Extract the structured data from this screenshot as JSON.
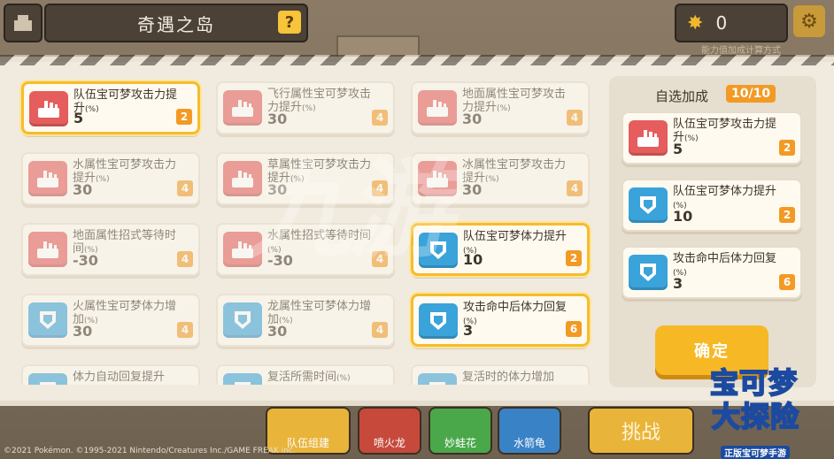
{
  "header": {
    "title": "奇遇之岛",
    "help_label": "?",
    "coins": "0",
    "sub_caption": "能力值加成计算方式"
  },
  "panel": {
    "options": [
      {
        "name": "队伍宝可梦攻击力提升",
        "pct": "(%)",
        "value": "5",
        "cost": "2",
        "icon": "red",
        "selected": true,
        "dim": false
      },
      {
        "name": "飞行属性宝可梦攻击力提升",
        "pct": "(%)",
        "value": "30",
        "cost": "4",
        "icon": "red",
        "selected": false,
        "dim": true
      },
      {
        "name": "地面属性宝可梦攻击力提升",
        "pct": "(%)",
        "value": "30",
        "cost": "4",
        "icon": "red",
        "selected": false,
        "dim": true
      },
      {
        "name": "水属性宝可梦攻击力提升",
        "pct": "(%)",
        "value": "30",
        "cost": "4",
        "icon": "red",
        "selected": false,
        "dim": true
      },
      {
        "name": "草属性宝可梦攻击力提升",
        "pct": "(%)",
        "value": "30",
        "cost": "4",
        "icon": "red",
        "selected": false,
        "dim": true
      },
      {
        "name": "冰属性宝可梦攻击力提升",
        "pct": "(%)",
        "value": "30",
        "cost": "4",
        "icon": "red",
        "selected": false,
        "dim": true
      },
      {
        "name": "地面属性招式等待时间",
        "pct": "(%)",
        "value": "-30",
        "cost": "4",
        "icon": "red",
        "selected": false,
        "dim": true
      },
      {
        "name": "水属性招式等待时间",
        "pct": "(%)",
        "value": "-30",
        "cost": "4",
        "icon": "red",
        "selected": false,
        "dim": true
      },
      {
        "name": "队伍宝可梦体力提升",
        "pct": "(%)",
        "value": "10",
        "cost": "2",
        "icon": "blue",
        "selected": true,
        "dim": false
      },
      {
        "name": "火属性宝可梦体力增加",
        "pct": "(%)",
        "value": "30",
        "cost": "4",
        "icon": "blue",
        "selected": false,
        "dim": true
      },
      {
        "name": "龙属性宝可梦体力增加",
        "pct": "(%)",
        "value": "30",
        "cost": "4",
        "icon": "blue",
        "selected": false,
        "dim": true
      },
      {
        "name": "攻击命中后体力回复",
        "pct": "(%)",
        "value": "3",
        "cost": "6",
        "icon": "blue",
        "selected": true,
        "dim": false
      },
      {
        "name": "体力自动回复提升",
        "pct": "",
        "value": "",
        "cost": "",
        "icon": "blue",
        "selected": false,
        "dim": true
      },
      {
        "name": "复活所需时间",
        "pct": "(%)",
        "value": "",
        "cost": "",
        "icon": "blue",
        "selected": false,
        "dim": true
      },
      {
        "name": "复活时的体力增加",
        "pct": "",
        "value": "",
        "cost": "",
        "icon": "blue",
        "selected": false,
        "dim": true
      }
    ]
  },
  "selected_panel": {
    "title": "自选加成",
    "count": "10/10",
    "items": [
      {
        "name": "队伍宝可梦攻击力提升",
        "pct": "(%)",
        "value": "5",
        "cost": "2",
        "icon": "red"
      },
      {
        "name": "队伍宝可梦体力提升",
        "pct": "(%)",
        "value": "10",
        "cost": "2",
        "icon": "blue"
      },
      {
        "name": "攻击命中后体力回复",
        "pct": "(%)",
        "value": "3",
        "cost": "6",
        "icon": "blue"
      }
    ],
    "confirm_label": "确定"
  },
  "bottom": {
    "team_label": "队伍组建",
    "pokemon": [
      "喷火龙",
      "妙蛙花",
      "水箭龟"
    ],
    "challenge_label": "挑战",
    "copyright": "©2021 Pokémon. ©1995-2021 Nintendo/Creatures Inc./GAME FREAK inc."
  },
  "watermark": "九游",
  "logo": {
    "line1": "宝可梦",
    "line2": "大探险",
    "line3": "正版宝可梦手游"
  },
  "colors": {
    "accent": "#f5bc2f",
    "cost_badge": "#f29a24",
    "attack_icon": "#e55d5d",
    "hp_icon": "#39a3da"
  }
}
